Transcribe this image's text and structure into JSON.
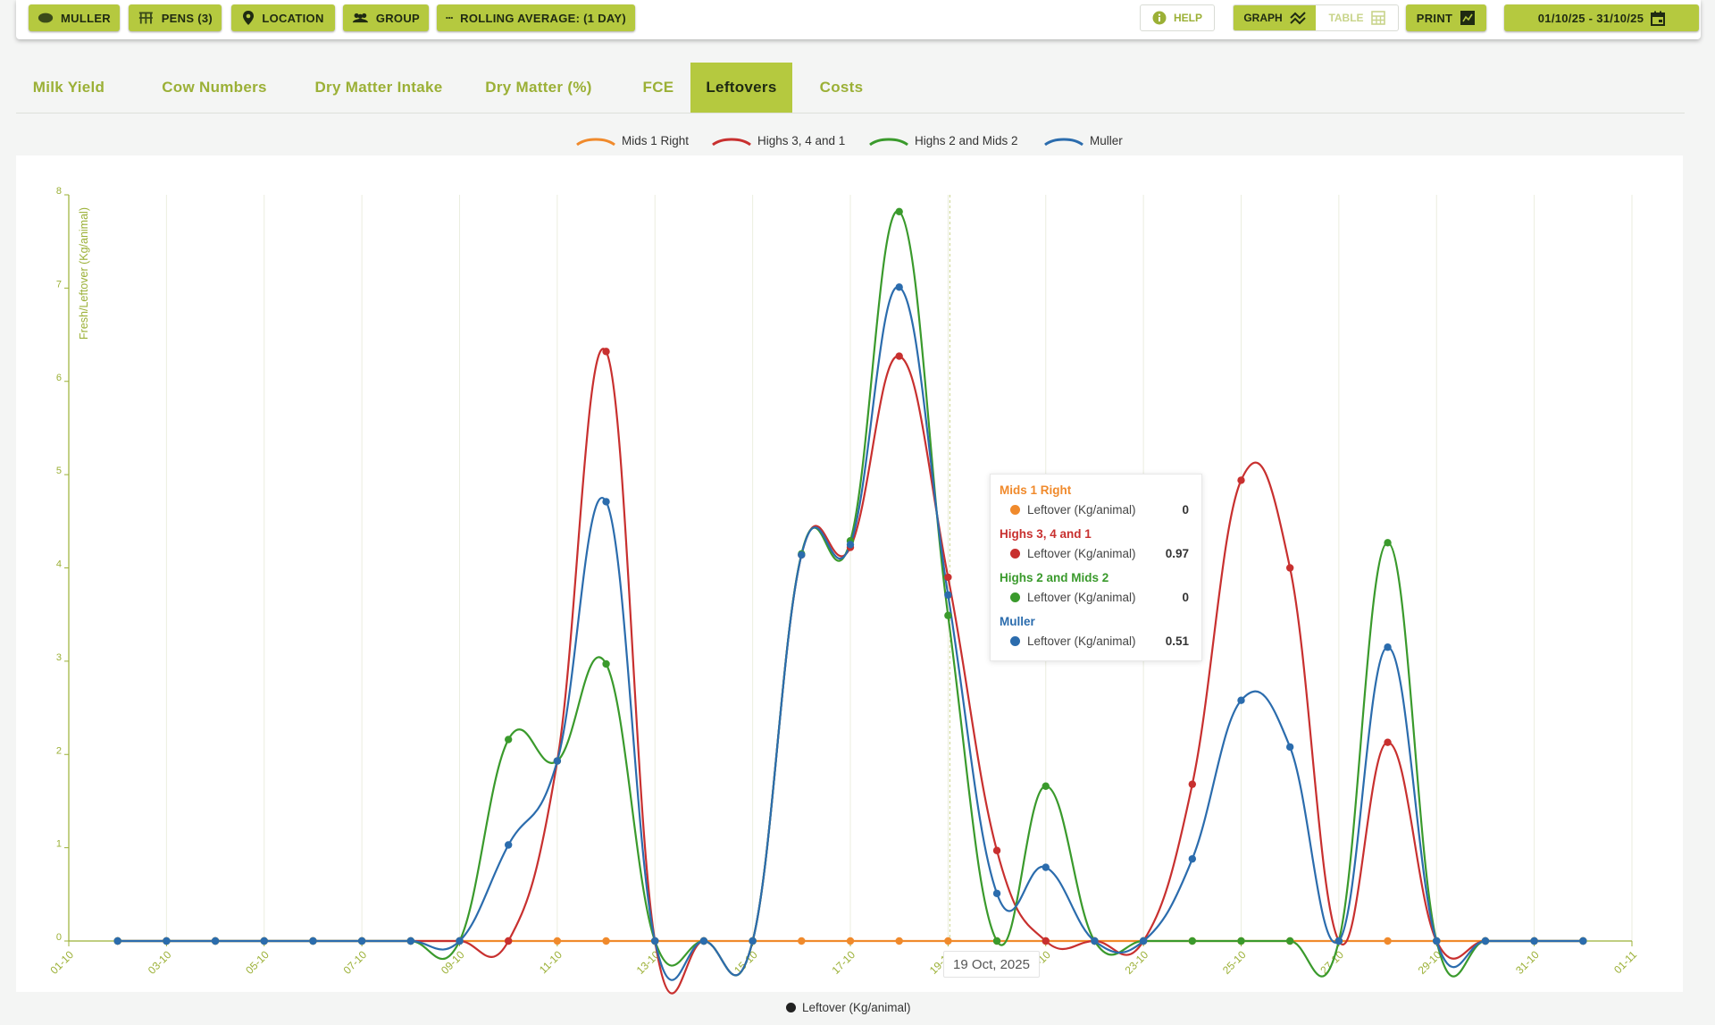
{
  "toolbar": {
    "muller": "MULLER",
    "pens": "PENS (3)",
    "location": "LOCATION",
    "group": "GROUP",
    "rolling": "ROLLING AVERAGE: (1 DAY)",
    "help": "HELP",
    "graph": "GRAPH",
    "table": "TABLE",
    "print": "PRINT",
    "date_range": "01/10/25 - 31/10/25"
  },
  "tabs": [
    "Milk Yield",
    "Cow Numbers",
    "Dry Matter Intake",
    "Dry Matter (%)",
    "FCE",
    "Leftovers",
    "Costs"
  ],
  "active_tab": "Leftovers",
  "colors": {
    "accent": "#b5c93f",
    "mids1right": "#f08a2c",
    "highs341": "#c8302f",
    "highs2mids2": "#3a9a2c",
    "muller": "#2b6cad",
    "axis": "#9bb036"
  },
  "tooltip": {
    "series": [
      {
        "name": "Mids 1 Right",
        "label": "Leftover (Kg/animal)",
        "value": "0"
      },
      {
        "name": "Highs 3, 4 and 1",
        "label": "Leftover (Kg/animal)",
        "value": "0.97"
      },
      {
        "name": "Highs 2 and Mids 2",
        "label": "Leftover (Kg/animal)",
        "value": "0"
      },
      {
        "name": "Muller",
        "label": "Leftover (Kg/animal)",
        "value": "0.51"
      }
    ]
  },
  "hover_date": "19 Oct, 2025",
  "bottom_legend": "Leftover (Kg/animal)",
  "chart_data": {
    "type": "line",
    "ylabel": "Fresh/Leftover (Kg/animal)",
    "ylim": [
      0,
      8
    ],
    "yticks": [
      0,
      1,
      2,
      3,
      4,
      5,
      6,
      7,
      8
    ],
    "xticks": [
      "01-10",
      "03-10",
      "05-10",
      "07-10",
      "09-10",
      "11-10",
      "13-10",
      "15-10",
      "17-10",
      "19-10",
      "21-10",
      "23-10",
      "25-10",
      "27-10",
      "29-10",
      "31-10",
      "01-11"
    ],
    "x": [
      "02-10",
      "03-10",
      "04-10",
      "05-10",
      "06-10",
      "07-10",
      "08-10",
      "09-10",
      "10-10",
      "11-10",
      "12-10",
      "13-10",
      "14-10",
      "15-10",
      "16-10",
      "17-10",
      "18-10",
      "19-10",
      "20-10",
      "21-10",
      "22-10",
      "23-10",
      "24-10",
      "25-10",
      "26-10",
      "27-10",
      "28-10",
      "29-10",
      "30-10",
      "31-10",
      "01-11"
    ],
    "legend_position": "top",
    "grid": "vertical",
    "series": [
      {
        "name": "Mids 1 Right",
        "color": "#f08a2c",
        "values": [
          0,
          0,
          0,
          0,
          0,
          0,
          0,
          0,
          0,
          0,
          0,
          0,
          0,
          0,
          0,
          0,
          0,
          0,
          0,
          0,
          0,
          0,
          0,
          0,
          0,
          0,
          0,
          0,
          0,
          0,
          0
        ]
      },
      {
        "name": "Highs 3, 4 and 1",
        "color": "#c8302f",
        "values": [
          0,
          0,
          0,
          0,
          0,
          0,
          0,
          0,
          0,
          1.93,
          6.32,
          0,
          0,
          0,
          4.14,
          4.22,
          6.27,
          3.9,
          0.97,
          0,
          0,
          0,
          1.68,
          4.94,
          4.0,
          0,
          2.13,
          0,
          0,
          0,
          0
        ]
      },
      {
        "name": "Highs 2 and Mids 2",
        "color": "#3a9a2c",
        "values": [
          0,
          0,
          0,
          0,
          0,
          0,
          0,
          0,
          2.16,
          1.93,
          2.97,
          0,
          0,
          0,
          4.15,
          4.29,
          7.82,
          3.49,
          0,
          1.66,
          0,
          0,
          0,
          0,
          0,
          0,
          4.27,
          0,
          0,
          0,
          0
        ]
      },
      {
        "name": "Muller",
        "color": "#2b6cad",
        "values": [
          0,
          0,
          0,
          0,
          0,
          0,
          0,
          0,
          1.03,
          1.93,
          4.71,
          0,
          0,
          0,
          4.14,
          4.25,
          7.01,
          3.71,
          0.51,
          0.79,
          0,
          0,
          0.88,
          2.58,
          2.08,
          0,
          3.15,
          0,
          0,
          0,
          0
        ]
      }
    ]
  }
}
